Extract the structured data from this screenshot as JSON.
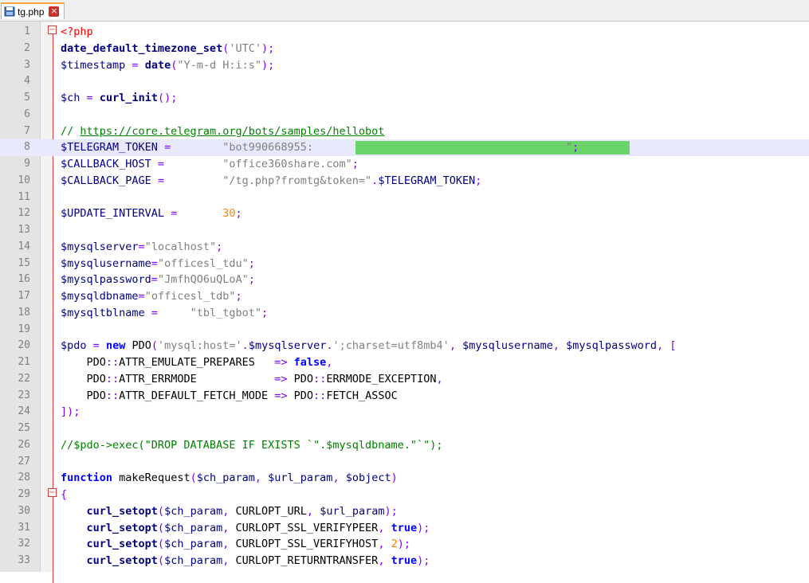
{
  "tab": {
    "filename": "tg.php",
    "close_symbol": "×",
    "file_icon": "file-icon"
  },
  "fold_symbol": "−",
  "colors": {
    "keyword": "#0000ff",
    "function": "#000080",
    "variable": "#000080",
    "string": "#808080",
    "number": "#ff8000",
    "operator": "#8000ff",
    "comment": "#008000",
    "php_tag": "#ff0000",
    "redaction": "#6ad36a",
    "current_line": "#e8e8ff"
  },
  "current_line": 8,
  "fold_markers": [
    1,
    29
  ],
  "lines": [
    [
      [
        "tag",
        "<?php"
      ]
    ],
    [
      [
        "fn",
        "date_default_timezone_set"
      ],
      [
        "op",
        "("
      ],
      [
        "str",
        "'UTC'"
      ],
      [
        "op",
        ");"
      ]
    ],
    [
      [
        "var",
        "$timestamp"
      ],
      [
        "pl",
        " "
      ],
      [
        "op",
        "="
      ],
      [
        "pl",
        " "
      ],
      [
        "fn",
        "date"
      ],
      [
        "op",
        "("
      ],
      [
        "str",
        "\"Y-m-d H:i:s\""
      ],
      [
        "op",
        ");"
      ]
    ],
    [],
    [
      [
        "var",
        "$ch"
      ],
      [
        "pl",
        " "
      ],
      [
        "op",
        "="
      ],
      [
        "pl",
        " "
      ],
      [
        "fn",
        "curl_init"
      ],
      [
        "op",
        "();"
      ]
    ],
    [],
    [
      [
        "cmt",
        "// "
      ],
      [
        "url",
        "https://core.telegram.org/bots/samples/hellobot"
      ]
    ],
    [
      [
        "var",
        "$TELEGRAM_TOKEN"
      ],
      [
        "pl",
        " "
      ],
      [
        "op",
        "="
      ],
      [
        "pl",
        "        "
      ],
      [
        "str",
        "\"bot990668955:"
      ],
      [
        "pl",
        "                                       "
      ],
      [
        "str",
        "\""
      ],
      [
        "op",
        ";"
      ]
    ],
    [
      [
        "var",
        "$CALLBACK_HOST"
      ],
      [
        "pl",
        " "
      ],
      [
        "op",
        "="
      ],
      [
        "pl",
        "         "
      ],
      [
        "str",
        "\"office360share.com\""
      ],
      [
        "op",
        ";"
      ]
    ],
    [
      [
        "var",
        "$CALLBACK_PAGE"
      ],
      [
        "pl",
        " "
      ],
      [
        "op",
        "="
      ],
      [
        "pl",
        "         "
      ],
      [
        "str",
        "\"/tg.php?fromtg&token=\""
      ],
      [
        "op",
        "."
      ],
      [
        "var",
        "$TELEGRAM_TOKEN"
      ],
      [
        "op",
        ";"
      ]
    ],
    [],
    [
      [
        "var",
        "$UPDATE_INTERVAL"
      ],
      [
        "pl",
        " "
      ],
      [
        "op",
        "="
      ],
      [
        "pl",
        "       "
      ],
      [
        "num",
        "30"
      ],
      [
        "op",
        ";"
      ]
    ],
    [],
    [
      [
        "var",
        "$mysqlserver"
      ],
      [
        "op",
        "="
      ],
      [
        "str",
        "\"localhost\""
      ],
      [
        "op",
        ";"
      ]
    ],
    [
      [
        "var",
        "$mysqlusername"
      ],
      [
        "op",
        "="
      ],
      [
        "str",
        "\"officesl_tdu\""
      ],
      [
        "op",
        ";"
      ]
    ],
    [
      [
        "var",
        "$mysqlpassword"
      ],
      [
        "op",
        "="
      ],
      [
        "str",
        "\"JmfhQO6uQLoA\""
      ],
      [
        "op",
        ";"
      ]
    ],
    [
      [
        "var",
        "$mysqldbname"
      ],
      [
        "op",
        "="
      ],
      [
        "str",
        "\"officesl_tdb\""
      ],
      [
        "op",
        ";"
      ]
    ],
    [
      [
        "var",
        "$mysqltblname"
      ],
      [
        "pl",
        " "
      ],
      [
        "op",
        "="
      ],
      [
        "pl",
        "     "
      ],
      [
        "str",
        "\"tbl_tgbot\""
      ],
      [
        "op",
        ";"
      ]
    ],
    [],
    [
      [
        "var",
        "$pdo"
      ],
      [
        "pl",
        " "
      ],
      [
        "op",
        "="
      ],
      [
        "pl",
        " "
      ],
      [
        "kw",
        "new"
      ],
      [
        "pl",
        " "
      ],
      [
        "cls",
        "PDO"
      ],
      [
        "op",
        "("
      ],
      [
        "str",
        "'mysql:host='"
      ],
      [
        "op",
        "."
      ],
      [
        "var",
        "$mysqlserver"
      ],
      [
        "op",
        "."
      ],
      [
        "str",
        "';charset=utf8mb4'"
      ],
      [
        "op",
        ","
      ],
      [
        "pl",
        " "
      ],
      [
        "var",
        "$mysqlusername"
      ],
      [
        "op",
        ","
      ],
      [
        "pl",
        " "
      ],
      [
        "var",
        "$mysqlpassword"
      ],
      [
        "op",
        ","
      ],
      [
        "pl",
        " "
      ],
      [
        "op",
        "["
      ]
    ],
    [
      [
        "pl",
        "    "
      ],
      [
        "cls",
        "PDO"
      ],
      [
        "op",
        "::"
      ],
      [
        "cls",
        "ATTR_EMULATE_PREPARES"
      ],
      [
        "pl",
        "   "
      ],
      [
        "op",
        "=>"
      ],
      [
        "pl",
        " "
      ],
      [
        "kw",
        "false"
      ],
      [
        "op",
        ","
      ]
    ],
    [
      [
        "pl",
        "    "
      ],
      [
        "cls",
        "PDO"
      ],
      [
        "op",
        "::"
      ],
      [
        "cls",
        "ATTR_ERRMODE"
      ],
      [
        "pl",
        "            "
      ],
      [
        "op",
        "=>"
      ],
      [
        "pl",
        " "
      ],
      [
        "cls",
        "PDO"
      ],
      [
        "op",
        "::"
      ],
      [
        "cls",
        "ERRMODE_EXCEPTION"
      ],
      [
        "op",
        ","
      ]
    ],
    [
      [
        "pl",
        "    "
      ],
      [
        "cls",
        "PDO"
      ],
      [
        "op",
        "::"
      ],
      [
        "cls",
        "ATTR_DEFAULT_FETCH_MODE"
      ],
      [
        "pl",
        " "
      ],
      [
        "op",
        "=>"
      ],
      [
        "pl",
        " "
      ],
      [
        "cls",
        "PDO"
      ],
      [
        "op",
        "::"
      ],
      [
        "cls",
        "FETCH_ASSOC"
      ]
    ],
    [
      [
        "op",
        "]);"
      ]
    ],
    [],
    [
      [
        "cmt",
        "//$pdo->exec(\"DROP DATABASE IF EXISTS `\".$mysqldbname.\"`\");"
      ]
    ],
    [],
    [
      [
        "kw",
        "function"
      ],
      [
        "pl",
        " "
      ],
      [
        "cls",
        "makeRequest"
      ],
      [
        "op",
        "("
      ],
      [
        "var",
        "$ch_param"
      ],
      [
        "op",
        ","
      ],
      [
        "pl",
        " "
      ],
      [
        "var",
        "$url_param"
      ],
      [
        "op",
        ","
      ],
      [
        "pl",
        " "
      ],
      [
        "var",
        "$object"
      ],
      [
        "op",
        ")"
      ]
    ],
    [
      [
        "op",
        "{"
      ]
    ],
    [
      [
        "pl",
        "    "
      ],
      [
        "fn",
        "curl_setopt"
      ],
      [
        "op",
        "("
      ],
      [
        "var",
        "$ch_param"
      ],
      [
        "op",
        ","
      ],
      [
        "pl",
        " "
      ],
      [
        "cls",
        "CURLOPT_URL"
      ],
      [
        "op",
        ","
      ],
      [
        "pl",
        " "
      ],
      [
        "var",
        "$url_param"
      ],
      [
        "op",
        ");"
      ]
    ],
    [
      [
        "pl",
        "    "
      ],
      [
        "fn",
        "curl_setopt"
      ],
      [
        "op",
        "("
      ],
      [
        "var",
        "$ch_param"
      ],
      [
        "op",
        ","
      ],
      [
        "pl",
        " "
      ],
      [
        "cls",
        "CURLOPT_SSL_VERIFYPEER"
      ],
      [
        "op",
        ","
      ],
      [
        "pl",
        " "
      ],
      [
        "kw",
        "true"
      ],
      [
        "op",
        ");"
      ]
    ],
    [
      [
        "pl",
        "    "
      ],
      [
        "fn",
        "curl_setopt"
      ],
      [
        "op",
        "("
      ],
      [
        "var",
        "$ch_param"
      ],
      [
        "op",
        ","
      ],
      [
        "pl",
        " "
      ],
      [
        "cls",
        "CURLOPT_SSL_VERIFYHOST"
      ],
      [
        "op",
        ","
      ],
      [
        "pl",
        " "
      ],
      [
        "num",
        "2"
      ],
      [
        "op",
        ");"
      ]
    ],
    [
      [
        "pl",
        "    "
      ],
      [
        "fn",
        "curl_setopt"
      ],
      [
        "op",
        "("
      ],
      [
        "var",
        "$ch_param"
      ],
      [
        "op",
        ","
      ],
      [
        "pl",
        " "
      ],
      [
        "cls",
        "CURLOPT_RETURNTRANSFER"
      ],
      [
        "op",
        ","
      ],
      [
        "pl",
        " "
      ],
      [
        "kw",
        "true"
      ],
      [
        "op",
        ");"
      ]
    ]
  ]
}
